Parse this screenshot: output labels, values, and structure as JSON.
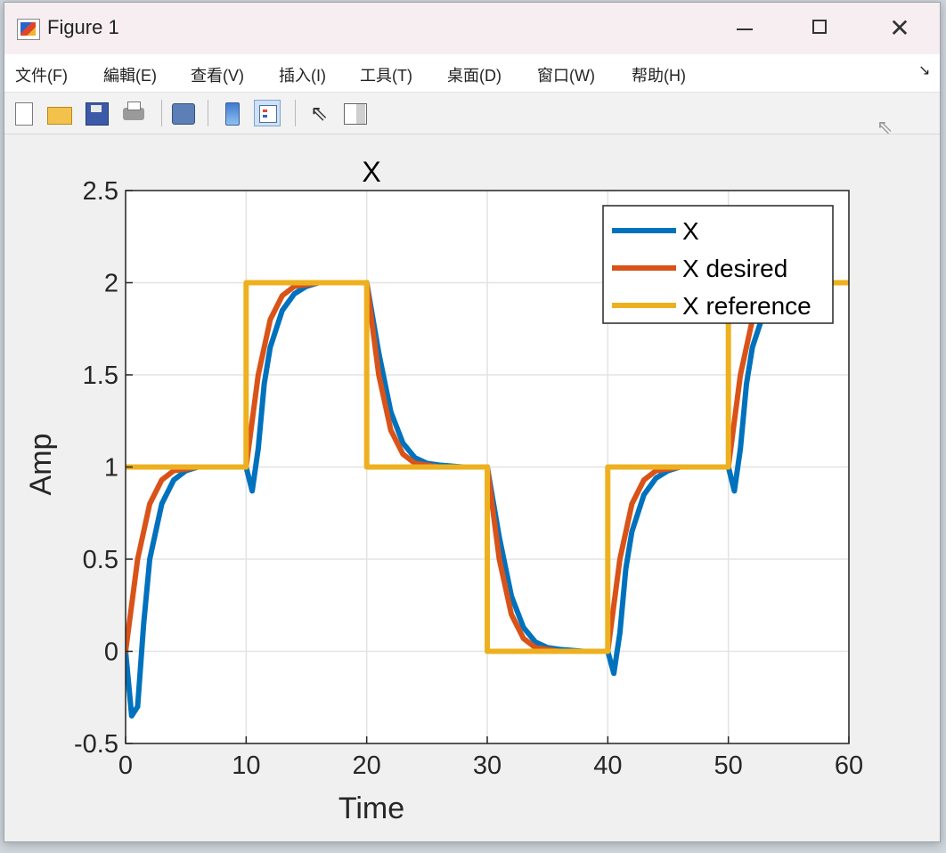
{
  "window": {
    "title": "Figure 1",
    "close_glyph": "✕"
  },
  "menu": [
    {
      "label": "文件(F)"
    },
    {
      "label": "編輯(E)"
    },
    {
      "label": "查看(V)"
    },
    {
      "label": "插入(I)"
    },
    {
      "label": "工具(T)"
    },
    {
      "label": "桌面(D)"
    },
    {
      "label": "窗口(W)"
    },
    {
      "label": "帮助(H)"
    }
  ],
  "menu_overflow_glyph": "↘",
  "toolbar": [
    {
      "icon": "new-file-icon"
    },
    {
      "icon": "open-folder-icon"
    },
    {
      "icon": "save-disk-icon"
    },
    {
      "icon": "print-icon"
    },
    {
      "icon": "link-plot-icon"
    },
    {
      "icon": "insert-colorbar-icon"
    },
    {
      "icon": "insert-legend-icon",
      "active": true
    },
    {
      "icon": "edit-pointer-icon"
    },
    {
      "icon": "plot-tools-icon"
    }
  ],
  "chart_data": {
    "type": "line",
    "title": "X",
    "xlabel": "Time",
    "ylabel": "Amp",
    "xlim": [
      0,
      60
    ],
    "ylim": [
      -0.5,
      2.5
    ],
    "xticks": [
      "0",
      "10",
      "20",
      "30",
      "40",
      "50",
      "60"
    ],
    "yticks": [
      "-0.5",
      "0",
      "0.5",
      "1",
      "1.5",
      "2",
      "2.5"
    ],
    "grid": true,
    "legend_position": "top-right",
    "series": [
      {
        "name": "X",
        "color": "#0072BD",
        "x": [
          0,
          0.5,
          1,
          1.5,
          2,
          3,
          4,
          5,
          6,
          8,
          10,
          10.5,
          11,
          11.5,
          12,
          13,
          14,
          15,
          16,
          18,
          20,
          21,
          22,
          23,
          24,
          25,
          26,
          28,
          30,
          31,
          32,
          33,
          34,
          35,
          36,
          38,
          40,
          40.5,
          41,
          41.5,
          42,
          43,
          44,
          45,
          46,
          48,
          50,
          50.5,
          51,
          51.5,
          52,
          53,
          54,
          55,
          56,
          58,
          60
        ],
        "y": [
          0,
          -0.35,
          -0.3,
          0.15,
          0.5,
          0.8,
          0.93,
          0.98,
          1.0,
          1.0,
          1.0,
          0.87,
          1.1,
          1.45,
          1.65,
          1.85,
          1.94,
          1.98,
          2.0,
          2.0,
          2.0,
          1.62,
          1.3,
          1.13,
          1.05,
          1.02,
          1.01,
          1.0,
          1.0,
          0.62,
          0.3,
          0.13,
          0.05,
          0.02,
          0.01,
          0.0,
          0.0,
          -0.12,
          0.1,
          0.45,
          0.65,
          0.85,
          0.94,
          0.98,
          1.0,
          1.0,
          1.0,
          0.87,
          1.1,
          1.45,
          1.65,
          1.85,
          1.94,
          1.98,
          2.0,
          2.0,
          2.0
        ]
      },
      {
        "name": "X desired",
        "color": "#D95319",
        "x": [
          0,
          1,
          2,
          3,
          4,
          5,
          6,
          8,
          10,
          11,
          12,
          13,
          14,
          15,
          16,
          18,
          20,
          21,
          22,
          23,
          24,
          25,
          26,
          28,
          30,
          31,
          32,
          33,
          34,
          35,
          36,
          38,
          40,
          41,
          42,
          43,
          44,
          45,
          46,
          48,
          50,
          51,
          52,
          53,
          54,
          55,
          56,
          58,
          60
        ],
        "y": [
          0,
          0.5,
          0.8,
          0.93,
          0.98,
          0.99,
          1.0,
          1.0,
          1.0,
          1.5,
          1.8,
          1.93,
          1.98,
          1.99,
          2.0,
          2.0,
          2.0,
          1.5,
          1.2,
          1.07,
          1.02,
          1.01,
          1.0,
          1.0,
          1.0,
          0.5,
          0.2,
          0.07,
          0.02,
          0.01,
          0.0,
          0.0,
          0.0,
          0.5,
          0.8,
          0.93,
          0.98,
          0.99,
          1.0,
          1.0,
          1.0,
          1.5,
          1.8,
          1.93,
          1.98,
          1.99,
          2.0,
          2.0,
          2.0
        ]
      },
      {
        "name": "X reference",
        "color": "#EDB120",
        "x": [
          0,
          10,
          10,
          20,
          20,
          30,
          30,
          40,
          40,
          50,
          50,
          60
        ],
        "y": [
          1,
          1,
          2,
          2,
          1,
          1,
          0,
          0,
          1,
          1,
          2,
          2
        ]
      }
    ]
  }
}
